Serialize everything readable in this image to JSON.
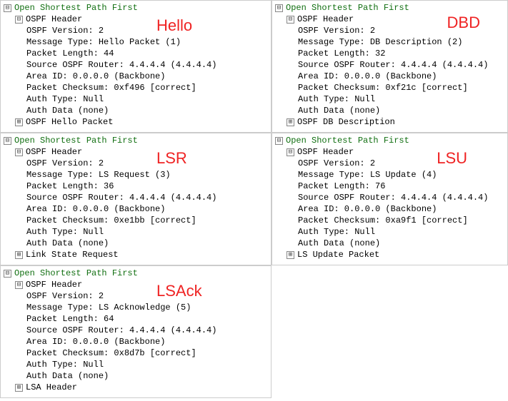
{
  "toggle_minus": "⊟",
  "toggle_plus": "⊞",
  "panels": [
    {
      "annotation": "Hello",
      "annot_class": "annot-hello",
      "protocol": "Open Shortest Path First",
      "header_label": "OSPF Header",
      "fields": {
        "version": "OSPF Version: 2",
        "msgtype": "Message Type: Hello Packet (1)",
        "length": "Packet Length: 44",
        "router": "Source OSPF Router: 4.4.4.4 (4.4.4.4)",
        "area": "Area ID: 0.0.0.0 (Backbone)",
        "checksum": "Packet Checksum: 0xf496 [correct]",
        "authtype": "Auth Type: Null",
        "authdata": "Auth Data (none)"
      },
      "sub_section": "OSPF Hello Packet"
    },
    {
      "annotation": "DBD",
      "annot_class": "annot-dbd",
      "protocol": "Open Shortest Path First",
      "header_label": "OSPF Header",
      "fields": {
        "version": "OSPF Version: 2",
        "msgtype": "Message Type: DB Description (2)",
        "length": "Packet Length: 32",
        "router": "Source OSPF Router: 4.4.4.4 (4.4.4.4)",
        "area": "Area ID: 0.0.0.0 (Backbone)",
        "checksum": "Packet Checksum: 0xf21c [correct]",
        "authtype": "Auth Type: Null",
        "authdata": "Auth Data (none)"
      },
      "sub_section": "OSPF DB Description"
    },
    {
      "annotation": "LSR",
      "annot_class": "annot-lsr",
      "protocol": "Open Shortest Path First",
      "header_label": "OSPF Header",
      "fields": {
        "version": "OSPF Version: 2",
        "msgtype": "Message Type: LS Request (3)",
        "length": "Packet Length: 36",
        "router": "Source OSPF Router: 4.4.4.4 (4.4.4.4)",
        "area": "Area ID: 0.0.0.0 (Backbone)",
        "checksum": "Packet Checksum: 0xe1bb [correct]",
        "authtype": "Auth Type: Null",
        "authdata": "Auth Data (none)"
      },
      "sub_section": "Link State Request"
    },
    {
      "annotation": "LSU",
      "annot_class": "annot-lsu",
      "protocol": "Open Shortest Path First",
      "header_label": "OSPF Header",
      "fields": {
        "version": "OSPF Version: 2",
        "msgtype": "Message Type: LS Update (4)",
        "length": "Packet Length: 76",
        "router": "Source OSPF Router: 4.4.4.4 (4.4.4.4)",
        "area": "Area ID: 0.0.0.0 (Backbone)",
        "checksum": "Packet Checksum: 0xa9f1 [correct]",
        "authtype": "Auth Type: Null",
        "authdata": "Auth Data (none)"
      },
      "sub_section": "LS Update Packet"
    },
    {
      "annotation": "LSAck",
      "annot_class": "annot-lsack",
      "protocol": "Open Shortest Path First",
      "header_label": "OSPF Header",
      "fields": {
        "version": "OSPF Version: 2",
        "msgtype": "Message Type: LS Acknowledge (5)",
        "length": "Packet Length: 64",
        "router": "Source OSPF Router: 4.4.4.4 (4.4.4.4)",
        "area": "Area ID: 0.0.0.0 (Backbone)",
        "checksum": "Packet Checksum: 0x8d7b [correct]",
        "authtype": "Auth Type: Null",
        "authdata": "Auth Data (none)"
      },
      "sub_section": "LSA Header"
    }
  ]
}
